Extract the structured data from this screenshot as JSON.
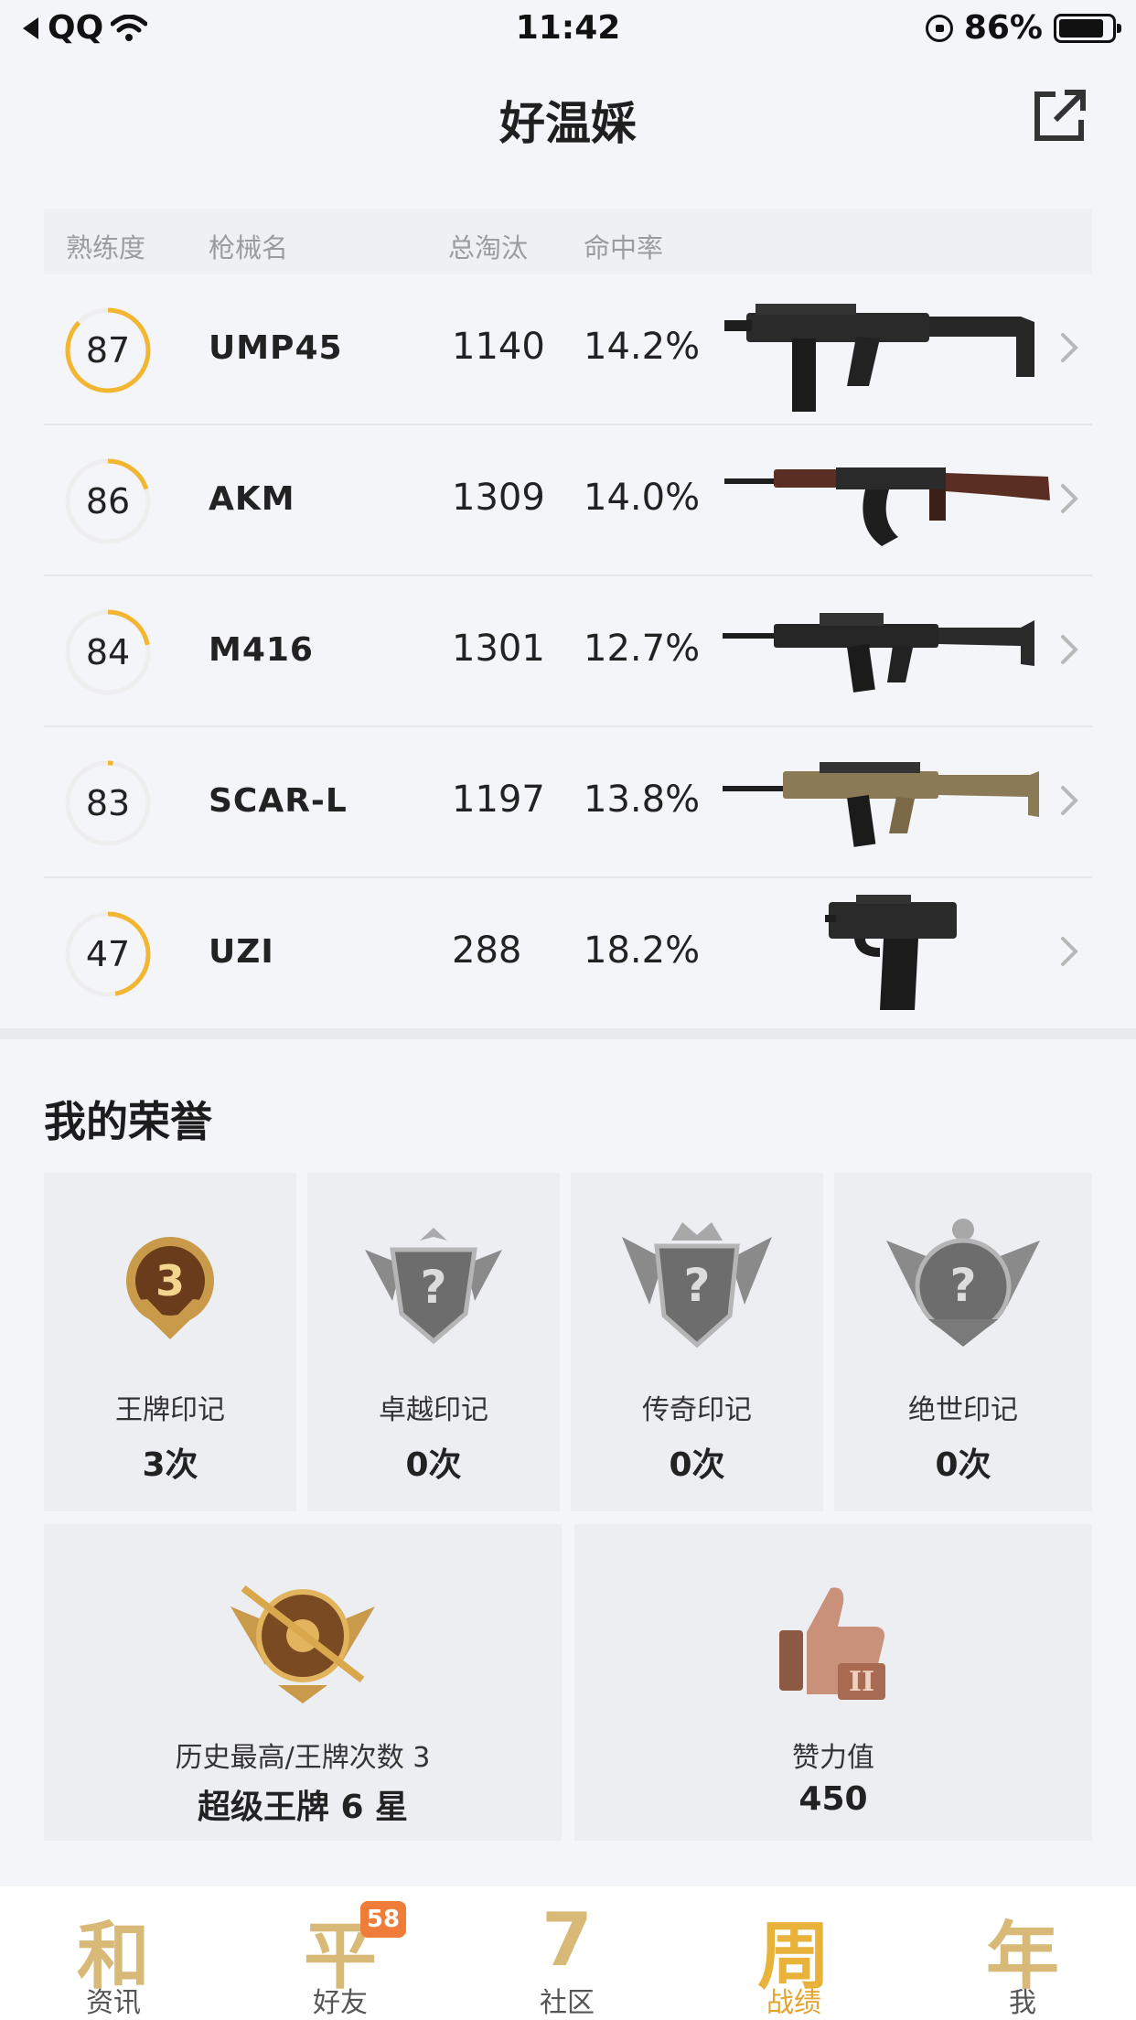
{
  "status_bar": {
    "back_app": "QQ",
    "time": "11:42",
    "battery": "86%"
  },
  "header": {
    "title": "好温婇"
  },
  "weapon_table": {
    "columns": [
      "熟练度",
      "枪械名",
      "总淘汰",
      "命中率"
    ],
    "rows": [
      {
        "proficiency": "87",
        "name": "UMP45",
        "kills": "1140",
        "hit_rate": "14.2%",
        "ring_fraction": 0.87,
        "weapon_icon": "smg-ump45"
      },
      {
        "proficiency": "86",
        "name": "AKM",
        "kills": "1309",
        "hit_rate": "14.0%",
        "ring_fraction": 0.2,
        "weapon_icon": "rifle-akm"
      },
      {
        "proficiency": "84",
        "name": "M416",
        "kills": "1301",
        "hit_rate": "12.7%",
        "ring_fraction": 0.22,
        "weapon_icon": "rifle-m416"
      },
      {
        "proficiency": "83",
        "name": "SCAR-L",
        "kills": "1197",
        "hit_rate": "13.8%",
        "ring_fraction": 0.02,
        "weapon_icon": "rifle-scar"
      },
      {
        "proficiency": "47",
        "name": "UZI",
        "kills": "288",
        "hit_rate": "18.2%",
        "ring_fraction": 0.47,
        "weapon_icon": "smg-uzi"
      }
    ]
  },
  "honors": {
    "title": "我的荣誉",
    "marks": [
      {
        "label": "王牌印记",
        "value": "3次",
        "badge_icon": "ace-mark-badge-icon",
        "badge_text": "3"
      },
      {
        "label": "卓越印记",
        "value": "0次",
        "badge_icon": "excellence-mark-badge-icon",
        "badge_text": "?"
      },
      {
        "label": "传奇印记",
        "value": "0次",
        "badge_icon": "legend-mark-badge-icon",
        "badge_text": "?"
      },
      {
        "label": "绝世印记",
        "value": "0次",
        "badge_icon": "peerless-mark-badge-icon",
        "badge_text": "?"
      }
    ],
    "highest": {
      "label": "历史最高/王牌次数 3",
      "value": "超级王牌 6 星",
      "icon": "ace-rank-emblem-icon"
    },
    "likes": {
      "label": "赞力值",
      "value": "450",
      "icon": "thumbs-up-icon"
    }
  },
  "bottom_nav": [
    {
      "label": "资讯",
      "glyph": "和",
      "active": false,
      "badge": ""
    },
    {
      "label": "好友",
      "glyph": "平",
      "active": false,
      "badge": "58"
    },
    {
      "label": "社区",
      "glyph": "7",
      "active": false,
      "badge": ""
    },
    {
      "label": "战绩",
      "glyph": "周",
      "active": true,
      "badge": ""
    },
    {
      "label": "我",
      "glyph": "年",
      "active": false,
      "badge": ""
    }
  ],
  "colors": {
    "ring": "#f2b632",
    "ring_track": "#eeeeee",
    "accent": "#e9b23a",
    "badge": "#f07c3a"
  }
}
